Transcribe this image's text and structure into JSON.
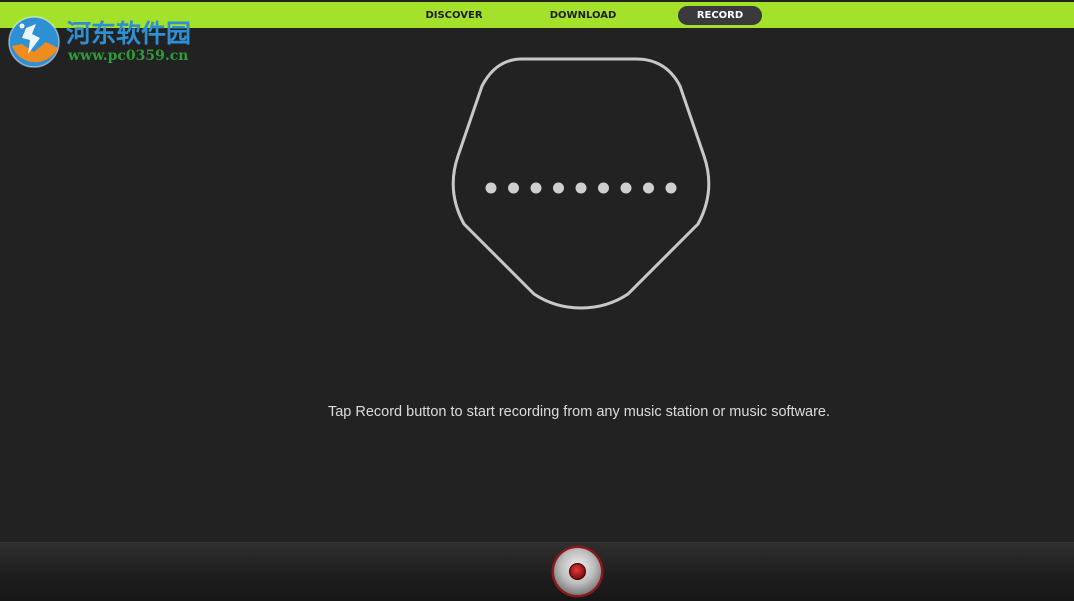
{
  "nav": {
    "tabs": [
      {
        "label": "DISCOVER",
        "active": false
      },
      {
        "label": "DOWNLOAD",
        "active": false
      },
      {
        "label": "RECORD",
        "active": true
      }
    ]
  },
  "watermark": {
    "title": "河东软件园",
    "url": "www.pc0359.cn"
  },
  "record_panel": {
    "instruction": "Tap Record button to start recording from any music station or music software.",
    "idle_dot_count": 9
  },
  "colors": {
    "accent_green": "#a3e12a",
    "background": "#222222",
    "record_red": "#c0141b"
  },
  "icons": {
    "record_button": "record-icon"
  }
}
